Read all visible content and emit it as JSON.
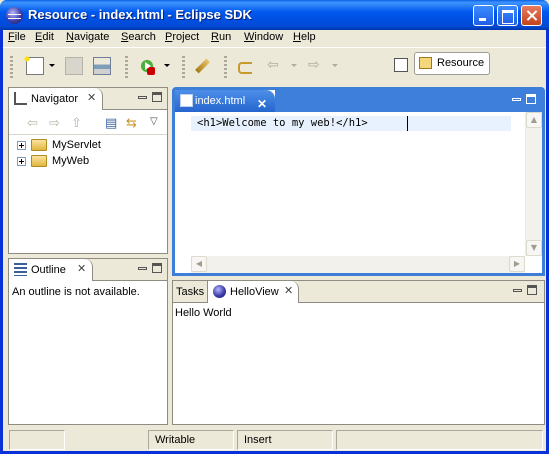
{
  "window": {
    "title": "Resource - index.html - Eclipse SDK"
  },
  "menu": [
    "File",
    "Edit",
    "Navigate",
    "Search",
    "Project",
    "Run",
    "Window",
    "Help"
  ],
  "toolbar": {
    "icons": [
      "new-wizard-icon",
      "save-icon",
      "print-icon",
      "run-icon",
      "pin-icon",
      "last-edit-icon",
      "back-icon",
      "forward-icon",
      "open-perspective-icon"
    ],
    "perspective_label": "Resource"
  },
  "navigator": {
    "title": "Navigator",
    "items": [
      {
        "label": "MyServlet"
      },
      {
        "label": "MyWeb"
      }
    ]
  },
  "outline": {
    "title": "Outline",
    "message": "An outline is not available."
  },
  "editor": {
    "tab_label": "index.html",
    "code": "<h1>Welcome to my web!</h1>"
  },
  "bottom_panel": {
    "tabs": [
      "Tasks",
      "HelloView"
    ],
    "content": "Hello World"
  },
  "statusbar": {
    "mode": "Writable",
    "insert": "Insert"
  },
  "colors": {
    "titlebar": "#0058ee",
    "active_tab": "#3d7ed8",
    "background": "#ece9d8"
  }
}
